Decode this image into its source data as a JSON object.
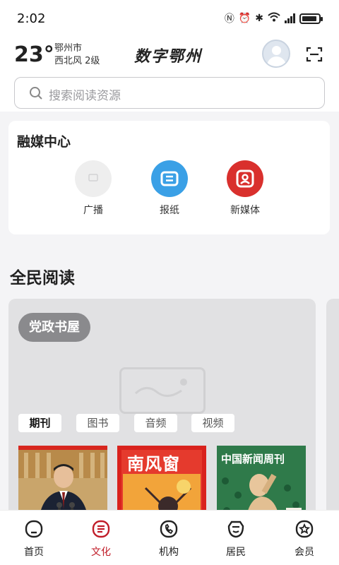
{
  "status_bar": {
    "time": "2:02",
    "icons": [
      "nfc-icon",
      "alarm-icon",
      "bluetooth-icon",
      "wifi-icon",
      "signal-icon",
      "battery-icon"
    ]
  },
  "header": {
    "temperature": "23°",
    "city": "鄂州市",
    "wind": "西北风  2级",
    "brand": "数字鄂州",
    "search_placeholder": "搜索阅读资源"
  },
  "media_center": {
    "title": "融媒中心",
    "items": [
      {
        "label": "广播",
        "color": "#eeeeee"
      },
      {
        "label": "报纸",
        "color": "#3aa0e6"
      },
      {
        "label": "新媒体",
        "color": "#d9302d"
      }
    ]
  },
  "reading": {
    "title": "全民阅读",
    "card_chip": "党政书屋",
    "tabs": [
      {
        "label": "期刊",
        "active": true
      },
      {
        "label": "图书",
        "active": false
      },
      {
        "label": "音频",
        "active": false
      },
      {
        "label": "视频",
        "active": false
      }
    ],
    "magazines": [
      {
        "title": "",
        "cover": "photo"
      },
      {
        "title": "南风窗",
        "cover": "red"
      },
      {
        "title": "中国新闻周刊",
        "cover": "green"
      }
    ]
  },
  "tabbar": {
    "accent": "#c01c28",
    "items": [
      {
        "label": "首页",
        "icon": "home-icon",
        "active": false
      },
      {
        "label": "文化",
        "icon": "culture-icon",
        "active": true
      },
      {
        "label": "机构",
        "icon": "phone-icon",
        "active": false
      },
      {
        "label": "居民",
        "icon": "resident-icon",
        "active": false
      },
      {
        "label": "会员",
        "icon": "member-icon",
        "active": false
      }
    ]
  }
}
